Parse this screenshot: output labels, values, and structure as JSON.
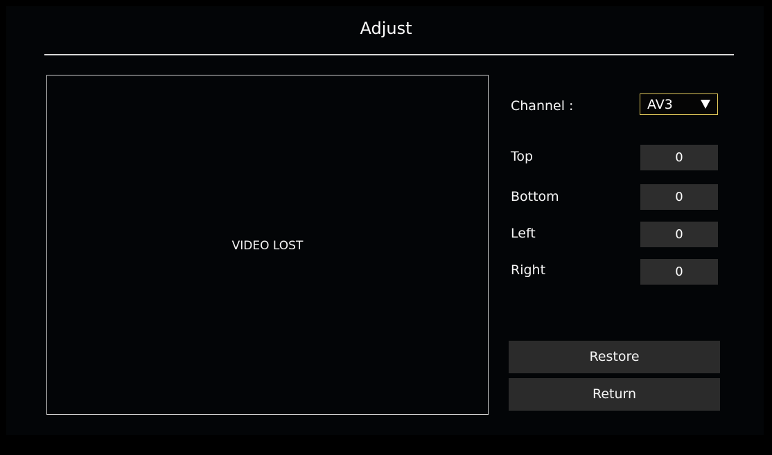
{
  "window": {
    "title": "Adjust"
  },
  "preview": {
    "status_text": "VIDEO LOST"
  },
  "channel": {
    "label": "Channel :",
    "selected": "AV3",
    "dropdown_icon": "triangle-down-icon",
    "highlight_color": "#e0c85a"
  },
  "settings": {
    "top": {
      "label": "Top",
      "value": "0"
    },
    "bottom": {
      "label": "Bottom",
      "value": "0"
    },
    "left": {
      "label": "Left",
      "value": "0"
    },
    "right": {
      "label": "Right",
      "value": "0"
    }
  },
  "buttons": {
    "restore_label": "Restore",
    "return_label": "Return"
  },
  "colors": {
    "background": "#000000",
    "panel": "#030507",
    "control": "#2d2d2d",
    "text": "#f5f5f5"
  }
}
